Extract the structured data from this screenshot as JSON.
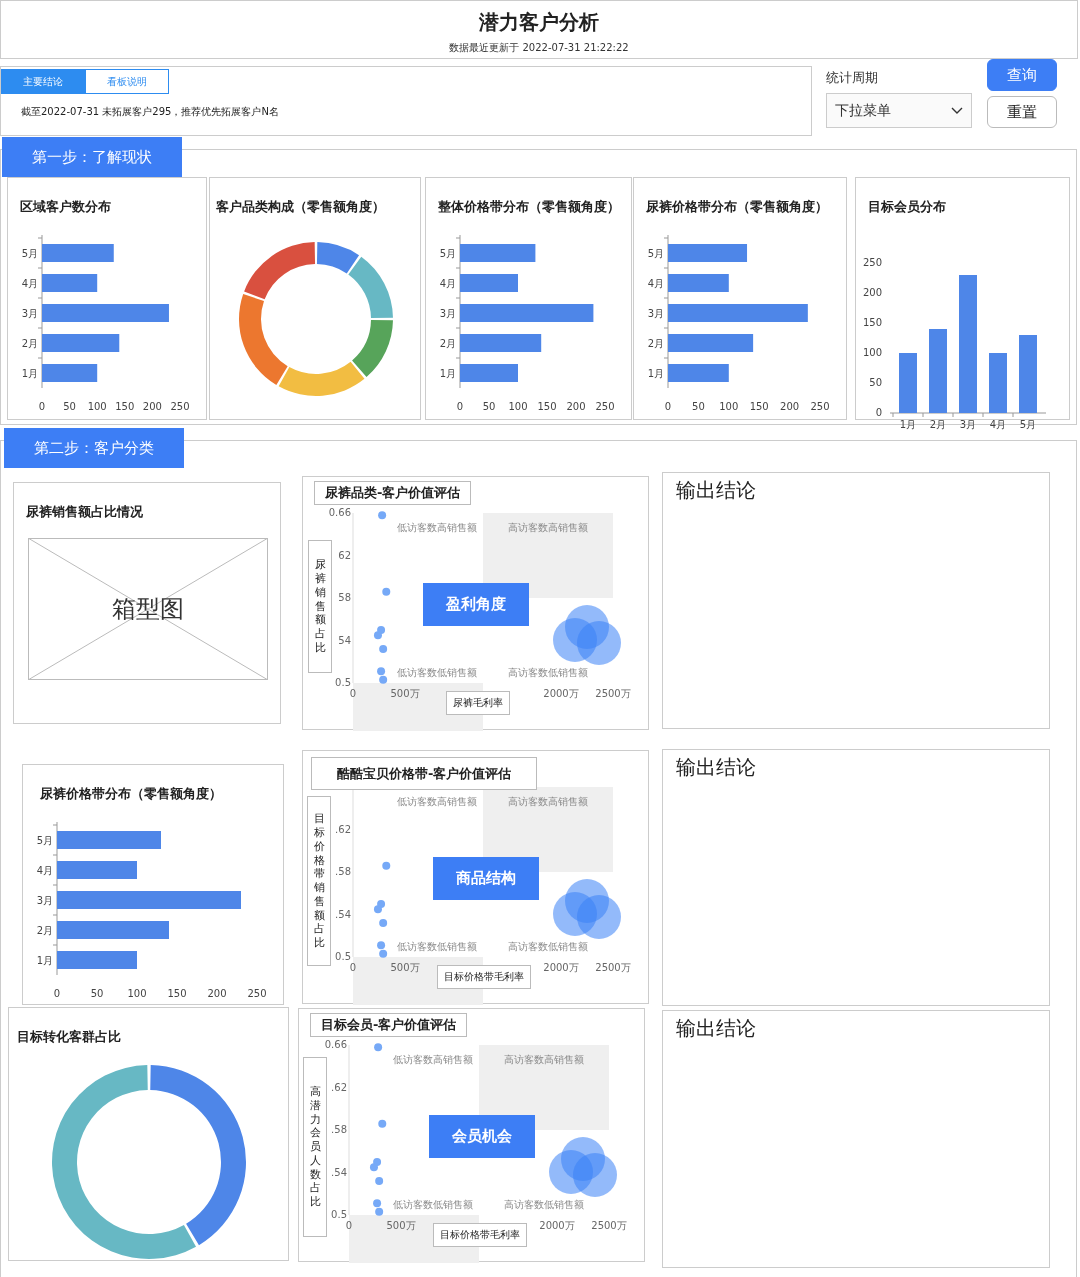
{
  "header": {
    "title": "潜力客户分析",
    "updated": "数据最近更新于 2022-07-31 21:22:22"
  },
  "summary": {
    "tabs": [
      {
        "label": "主要结论",
        "selected": true
      },
      {
        "label": "看板说明",
        "selected": false
      }
    ],
    "text": "截至2022-07-31 未拓展客户295，推荐优先拓展客户N名"
  },
  "filter": {
    "label": "统计周期",
    "dropdown": {
      "value": "下拉菜单"
    }
  },
  "buttons": [
    {
      "label": "查询",
      "kind": "primary"
    },
    {
      "label": "重置",
      "kind": "secondary"
    }
  ],
  "step1": {
    "title": "第一步：了解现状",
    "cards": [
      {
        "kind": "chart",
        "title": "区域客户数分布",
        "chart_data": {
          "type": "bar",
          "orientation": "horizontal",
          "categories": [
            "5月",
            "4月",
            "3月",
            "2月",
            "1月"
          ],
          "values": [
            130,
            100,
            230,
            140,
            100
          ],
          "xlim": [
            0,
            250
          ],
          "xticks": [
            0,
            50,
            100,
            150,
            200,
            250
          ]
        }
      },
      {
        "kind": "donut",
        "title": "客户品类构成（零售额角度）"
      },
      {
        "kind": "chart",
        "title": "整体价格带分布（零售额角度）",
        "chart_data": {
          "type": "bar",
          "orientation": "horizontal",
          "categories": [
            "5月",
            "4月",
            "3月",
            "2月",
            "1月"
          ],
          "values": [
            130,
            100,
            230,
            140,
            100
          ],
          "xlim": [
            0,
            250
          ],
          "xticks": [
            0,
            50,
            100,
            150,
            200,
            250
          ]
        }
      },
      {
        "kind": "chart",
        "title": "尿裤价格带分布（零售额角度）",
        "chart_data": {
          "type": "bar",
          "orientation": "horizontal",
          "categories": [
            "5月",
            "4月",
            "3月",
            "2月",
            "1月"
          ],
          "values": [
            130,
            100,
            230,
            140,
            100
          ],
          "xlim": [
            0,
            250
          ],
          "xticks": [
            0,
            50,
            100,
            150,
            200,
            250
          ]
        }
      },
      {
        "kind": "chart",
        "title": "目标会员分布",
        "chart_data": {
          "type": "bar",
          "orientation": "vertical",
          "categories": [
            "1月",
            "2月",
            "3月",
            "4月",
            "5月"
          ],
          "values": [
            100,
            140,
            230,
            100,
            130
          ],
          "ylim": [
            0,
            250
          ],
          "yticks": [
            0,
            50,
            100,
            150,
            200,
            250
          ]
        }
      }
    ]
  },
  "step2": {
    "title": "第二步：客户分类",
    "left": [
      {
        "kind": "placeholder",
        "title": "尿裤销售额占比情况",
        "label": "箱型图"
      },
      {
        "kind": "chart",
        "title": "尿裤价格带分布（零售额角度）",
        "chart_data": {
          "type": "bar",
          "orientation": "horizontal",
          "categories": [
            "5月",
            "4月",
            "3月",
            "2月",
            "1月"
          ],
          "values": [
            130,
            100,
            230,
            140,
            100
          ],
          "xlim": [
            0,
            250
          ],
          "xticks": [
            0,
            50,
            100,
            150,
            200,
            250
          ]
        }
      },
      {
        "kind": "donut",
        "title": "目标转化客群占比"
      }
    ],
    "middle": [
      {
        "badge": "盈利角度",
        "y_tick_labels_clipped": [
          "62",
          "58",
          "54"
        ],
        "quadrants": [
          {
            "label": "低访客数高销售额"
          },
          {
            "label": "高访客数高销售额"
          },
          {
            "label": "低访客数低销售额"
          },
          {
            "label": "高访客数低销售额"
          }
        ],
        "chart_data": {
          "type": "scatter",
          "title": "尿裤品类-客户价值评估",
          "xlabel": "尿裤毛利率",
          "ylabel": "尿裤销售额占比",
          "xlim": [
            0,
            2500
          ],
          "ylim": [
            0.5,
            0.66
          ],
          "xticks": [
            {
              "value": 0,
              "label": "0"
            },
            {
              "value": 500,
              "label": "500万"
            },
            {
              "value": 2000,
              "label": "2000万"
            },
            {
              "value": 2500,
              "label": "2500万"
            }
          ],
          "yticks": [
            {
              "value": 0.5,
              "label": "0.5"
            },
            {
              "value": 0.66,
              "label": "0.66"
            }
          ],
          "x": [
            280,
            320,
            270,
            240,
            290,
            270,
            290
          ],
          "series": [
            {
              "color": "#76a9f7",
              "values": [
                0.658,
                0.586,
                0.55,
                0.545,
                0.532,
                0.511,
                0.503
              ]
            }
          ]
        }
      },
      {
        "badge": "商品结构",
        "quadrants": [
          {
            "label": "低访客数高销售额"
          },
          {
            "label": "高访客数高销售额"
          },
          {
            "label": "低访客数低销售额"
          },
          {
            "label": "高访客数低销售额"
          }
        ],
        "chart_data": {
          "type": "scatter",
          "title": "酷酷宝贝价格带-客户价值评估",
          "xlabel": "目标价格带毛利率",
          "ylabel": "目标价格带销售额占比",
          "xlim": [
            0,
            2500
          ],
          "ylim": [
            0.5,
            0.66
          ],
          "xticks": [
            {
              "value": 0,
              "label": "0"
            },
            {
              "value": 500,
              "label": "500万"
            },
            {
              "value": 2000,
              "label": "2000万"
            },
            {
              "value": 2500,
              "label": "2500万"
            }
          ],
          "yticks": [
            {
              "value": 0.5,
              "label": "0.5"
            },
            {
              "value": 0.54,
              "label": ".54"
            },
            {
              "value": 0.58,
              "label": ".58"
            },
            {
              "value": 0.62,
              "label": ".62"
            }
          ],
          "x": [
            320,
            270,
            240,
            290,
            270,
            290
          ],
          "series": [
            {
              "color": "#76a9f7",
              "values": [
                0.586,
                0.55,
                0.545,
                0.532,
                0.511,
                0.503
              ]
            }
          ]
        }
      },
      {
        "badge": "会员机会",
        "quadrants": [
          {
            "label": "低访客数高销售额"
          },
          {
            "label": "高访客数高销售额"
          },
          {
            "label": "低访客数低销售额"
          },
          {
            "label": "高访客数低销售额"
          }
        ],
        "chart_data": {
          "type": "scatter",
          "title": "目标会员-客户价值评估",
          "xlabel": "目标价格带毛利率",
          "ylabel": "高潜力会员人数占比",
          "xlim": [
            0,
            2500
          ],
          "ylim": [
            0.5,
            0.66
          ],
          "xticks": [
            {
              "value": 0,
              "label": "0"
            },
            {
              "value": 500,
              "label": "500万"
            },
            {
              "value": 2000,
              "label": "2000万"
            },
            {
              "value": 2500,
              "label": "2500万"
            }
          ],
          "yticks": [
            {
              "value": 0.5,
              "label": "0.5"
            },
            {
              "value": 0.54,
              "label": ".54"
            },
            {
              "value": 0.58,
              "label": ".58"
            },
            {
              "value": 0.62,
              "label": ".62"
            },
            {
              "value": 0.66,
              "label": "0.66"
            }
          ],
          "x": [
            280,
            320,
            270,
            240,
            290,
            270,
            290
          ],
          "series": [
            {
              "color": "#76a9f7",
              "values": [
                0.658,
                0.586,
                0.55,
                0.545,
                0.532,
                0.511,
                0.503
              ]
            }
          ]
        }
      }
    ],
    "right": [
      {
        "title": "输出结论"
      },
      {
        "title": "输出结论"
      },
      {
        "title": "输出结论"
      }
    ]
  }
}
